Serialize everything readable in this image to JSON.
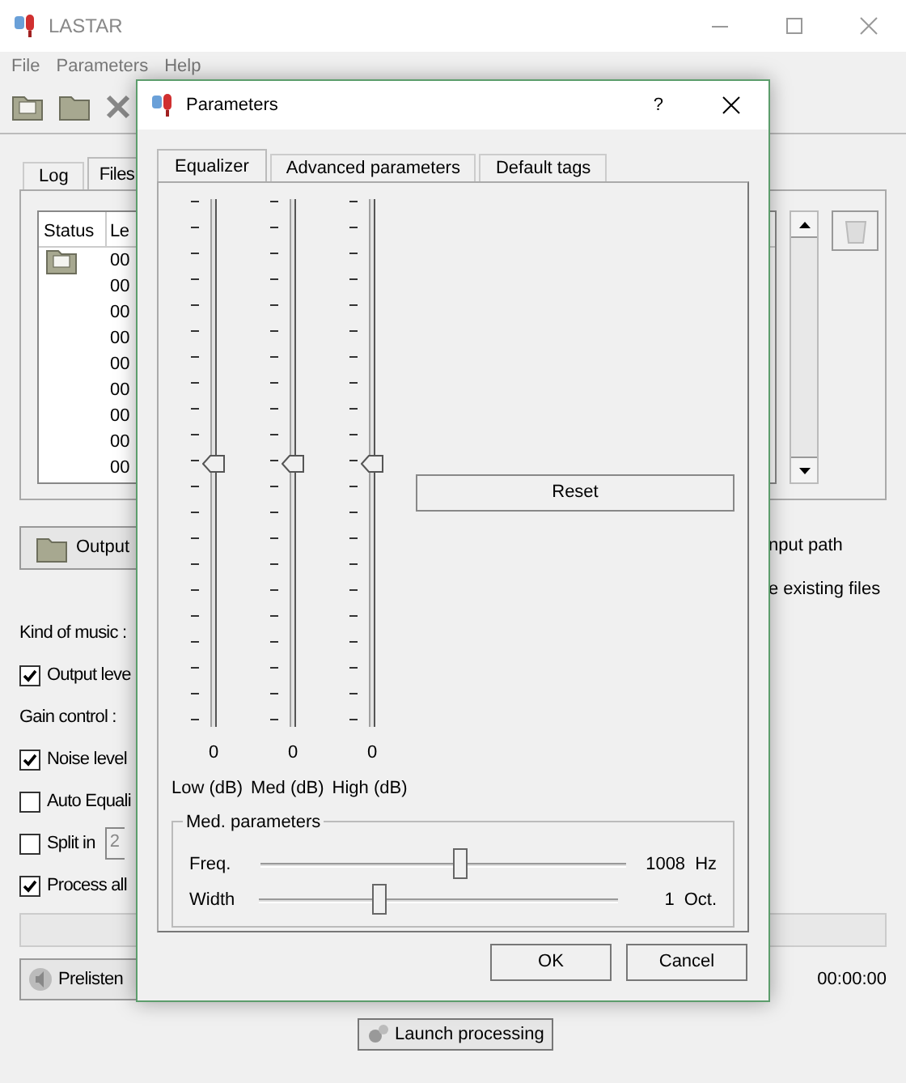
{
  "window": {
    "title": "LASTAR"
  },
  "menu": [
    "File",
    "Parameters",
    "Help"
  ],
  "tabs": [
    {
      "label": "Log",
      "selected": false
    },
    {
      "label": "Files",
      "selected": true
    }
  ],
  "file_list": {
    "columns": [
      "Status",
      "Le"
    ],
    "rows": [
      {
        "kind": "folder",
        "column_2": "00"
      },
      {
        "kind": "plain",
        "column_2": "00"
      },
      {
        "kind": "plain",
        "column_2": "00"
      },
      {
        "kind": "plain",
        "column_2": "00"
      },
      {
        "kind": "plain",
        "column_2": "00"
      },
      {
        "kind": "plain",
        "column_2": "00"
      },
      {
        "kind": "plain",
        "column_2": "00"
      },
      {
        "kind": "plain",
        "column_2": "00"
      },
      {
        "kind": "plain",
        "column_2": "00"
      }
    ]
  },
  "output_button": "Output",
  "right_texts": [
    "nput path",
    "e existing files"
  ],
  "options": [
    {
      "kind": "label",
      "label": "Kind of music :"
    },
    {
      "kind": "checkbox",
      "label": "Output leve",
      "checked": true
    },
    {
      "kind": "label",
      "label": "Gain control :"
    },
    {
      "kind": "checkbox",
      "label": "Noise level",
      "checked": true
    },
    {
      "kind": "checkbox",
      "label": "Auto Equali",
      "checked": false
    },
    {
      "kind": "checkbox",
      "label": "Split in",
      "checked": false,
      "field": "2"
    },
    {
      "kind": "checkbox",
      "label": "Process all",
      "checked": true
    }
  ],
  "progress": {
    "level": 0
  },
  "prelisten_button": "Prelisten",
  "time": "00:00:00",
  "launch_button": "Launch processing",
  "dialog": {
    "title": "Parameters",
    "help": "?",
    "tabs": [
      {
        "label": "Equalizer",
        "selected": true
      },
      {
        "label": "Advanced parameters",
        "selected": false
      },
      {
        "label": "Default tags",
        "selected": false
      }
    ],
    "bands": [
      {
        "value": "0",
        "label": "Low (dB)",
        "level": 0.5
      },
      {
        "value": "0",
        "label": "Med (dB)",
        "level": 0.5
      },
      {
        "value": "0",
        "label": "High (dB)",
        "level": 0.5
      }
    ],
    "reset_button": "Reset",
    "med_parameters": {
      "title": "Med. parameters",
      "rows": [
        {
          "label": "Freq.",
          "level": 0.53,
          "value": "1008",
          "unit": "Hz"
        },
        {
          "label": "Width",
          "level": 0.32,
          "value": "1",
          "unit": "Oct."
        }
      ]
    },
    "buttons": [
      "OK",
      "Cancel"
    ]
  }
}
